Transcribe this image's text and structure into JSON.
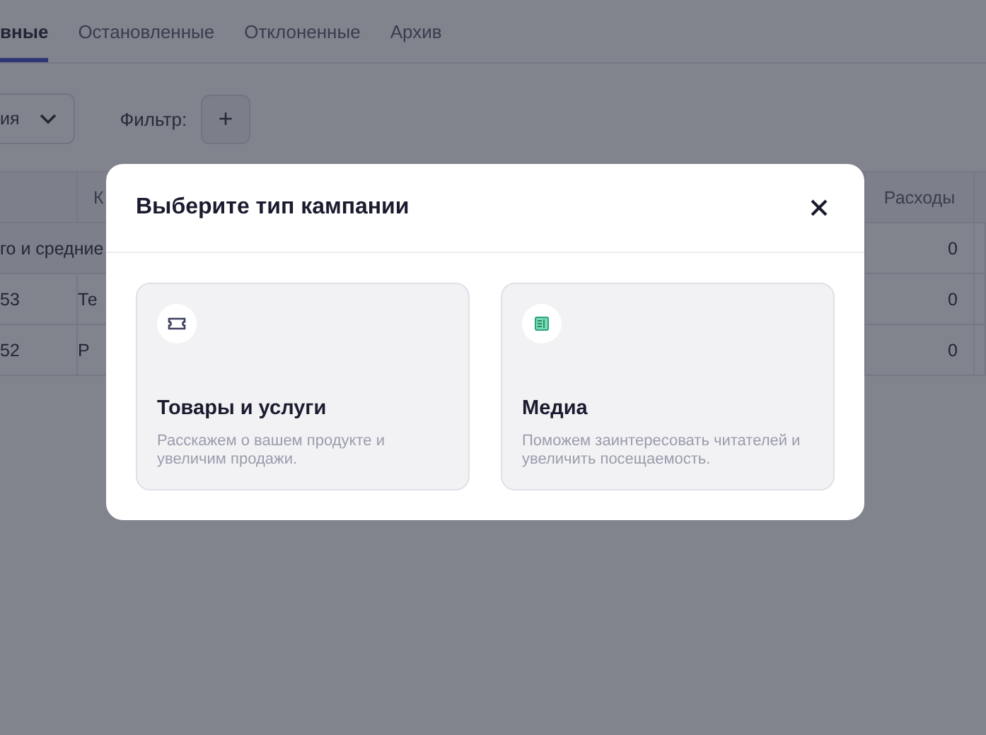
{
  "tabs": [
    {
      "label": "вные",
      "selected": true
    },
    {
      "label": "Остановленные",
      "selected": false
    },
    {
      "label": "Отклоненные",
      "selected": false
    },
    {
      "label": "Архив",
      "selected": false
    }
  ],
  "toolbar": {
    "dropdown_value": "ия",
    "filter_label": "Фильтр:",
    "add_button": "+"
  },
  "table": {
    "header": {
      "column_2": "К",
      "expenses": "Расходы"
    },
    "rows": [
      {
        "kind": "group",
        "label": "го и средние",
        "expenses": "0"
      },
      {
        "kind": "item",
        "column_1": "53",
        "column_2": "Те",
        "expenses": "0"
      },
      {
        "kind": "item",
        "column_1": "52",
        "column_2": "Р",
        "expenses": "0"
      }
    ]
  },
  "modal": {
    "title": "Выберите тип кампании",
    "options": [
      {
        "kind": "goods",
        "title": "Товары и услуги",
        "description": "Расскажем о вашем продукте и увеличим продажи."
      },
      {
        "kind": "media",
        "title": "Медиа",
        "description": "Поможем заинтересовать читателей и увеличить посещаемость."
      }
    ]
  }
}
